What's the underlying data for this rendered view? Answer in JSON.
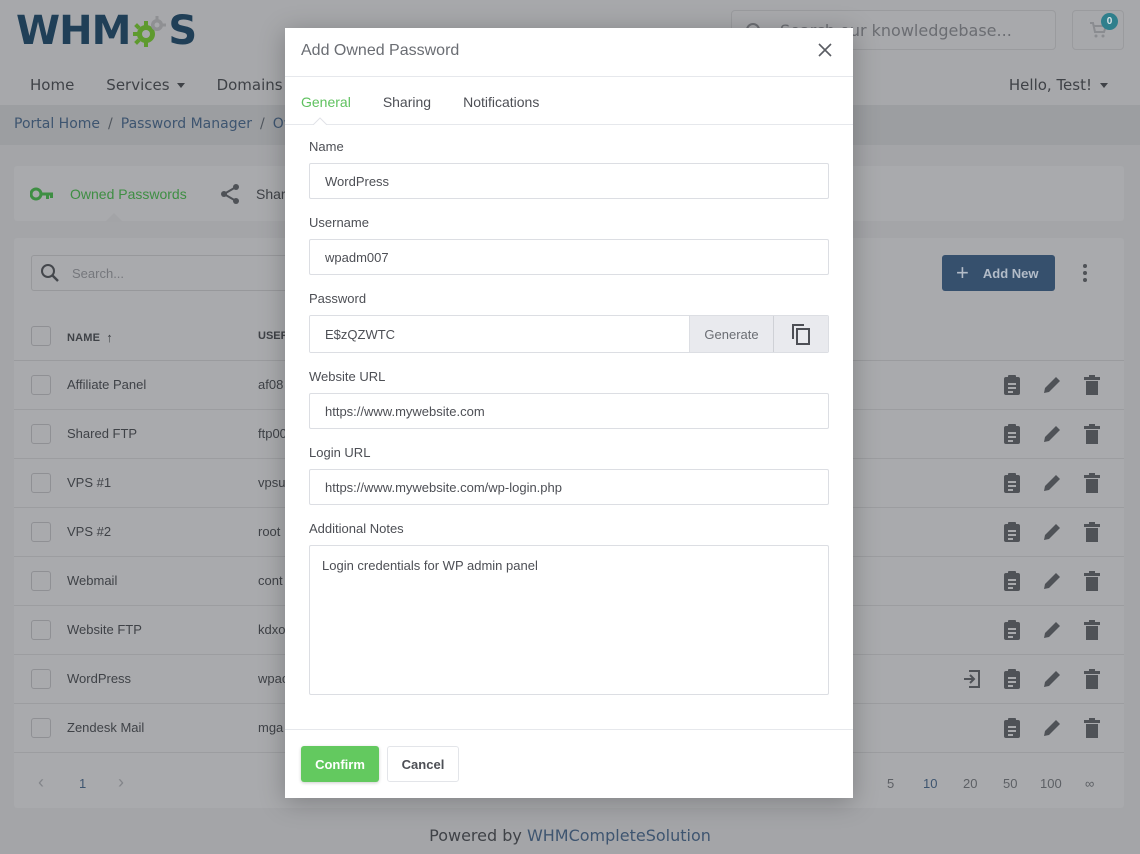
{
  "brand": {
    "logo_text_left": "WHM",
    "logo_text_right": "S",
    "logo_gear_color": "#5e9a2e",
    "logo_color": "#203f57"
  },
  "header": {
    "kb_search_placeholder": "Search our knowledgebase...",
    "cart_count": "0",
    "nav": [
      {
        "label": "Home",
        "has_caret": false
      },
      {
        "label": "Services",
        "has_caret": true
      },
      {
        "label": "Domains",
        "has_caret": true
      }
    ],
    "account_label": "Hello, Test!"
  },
  "breadcrumb": {
    "items": [
      "Portal Home",
      "Password Manager",
      "Ow"
    ],
    "separator": "/"
  },
  "page_tabs": {
    "owned_label": "Owned Passwords",
    "shared_label": "Shar",
    "active_color": "#3e8e43"
  },
  "table": {
    "search_placeholder": "Search...",
    "add_new_label": "Add New",
    "columns": {
      "name": "NAME",
      "username": "USER"
    },
    "sort_indicator": "↑",
    "rows": [
      {
        "name": "Affiliate Panel",
        "username": "af08",
        "login_icon": false
      },
      {
        "name": "Shared FTP",
        "username": "ftp00",
        "login_icon": false
      },
      {
        "name": "VPS #1",
        "username": "vpsu",
        "login_icon": false
      },
      {
        "name": "VPS #2",
        "username": "root",
        "login_icon": false
      },
      {
        "name": "Webmail",
        "username": "cont",
        "login_icon": false
      },
      {
        "name": "Website FTP",
        "username": "kdxo",
        "login_icon": false
      },
      {
        "name": "WordPress",
        "username": "wpac",
        "login_icon": true
      },
      {
        "name": "Zendesk Mail",
        "username": "mga",
        "login_icon": false
      }
    ],
    "pagination": {
      "prev": "‹",
      "current_page": "1",
      "next": "›",
      "page_sizes": [
        "5",
        "10",
        "20",
        "50",
        "100",
        "∞"
      ],
      "active_page_size": "10"
    }
  },
  "footer": {
    "prefix": "Powered by ",
    "link": "WHMCompleteSolution"
  },
  "modal": {
    "title": "Add Owned Password",
    "tabs": [
      {
        "label": "General",
        "active": true
      },
      {
        "label": "Sharing",
        "active": false
      },
      {
        "label": "Notifications",
        "active": false
      }
    ],
    "fields": {
      "name": {
        "label": "Name",
        "value": "WordPress"
      },
      "username": {
        "label": "Username",
        "value": "wpadm007"
      },
      "password": {
        "label": "Password",
        "value": "E$zQZWTC",
        "generate_label": "Generate"
      },
      "website_url": {
        "label": "Website URL",
        "value": "https://www.mywebsite.com"
      },
      "login_url": {
        "label": "Login URL",
        "value": "https://www.mywebsite.com/wp-login.php"
      },
      "notes": {
        "label": "Additional Notes",
        "value": "Login credentials for WP admin panel"
      }
    },
    "confirm_label": "Confirm",
    "cancel_label": "Cancel",
    "accent_color": "#63c95f"
  }
}
